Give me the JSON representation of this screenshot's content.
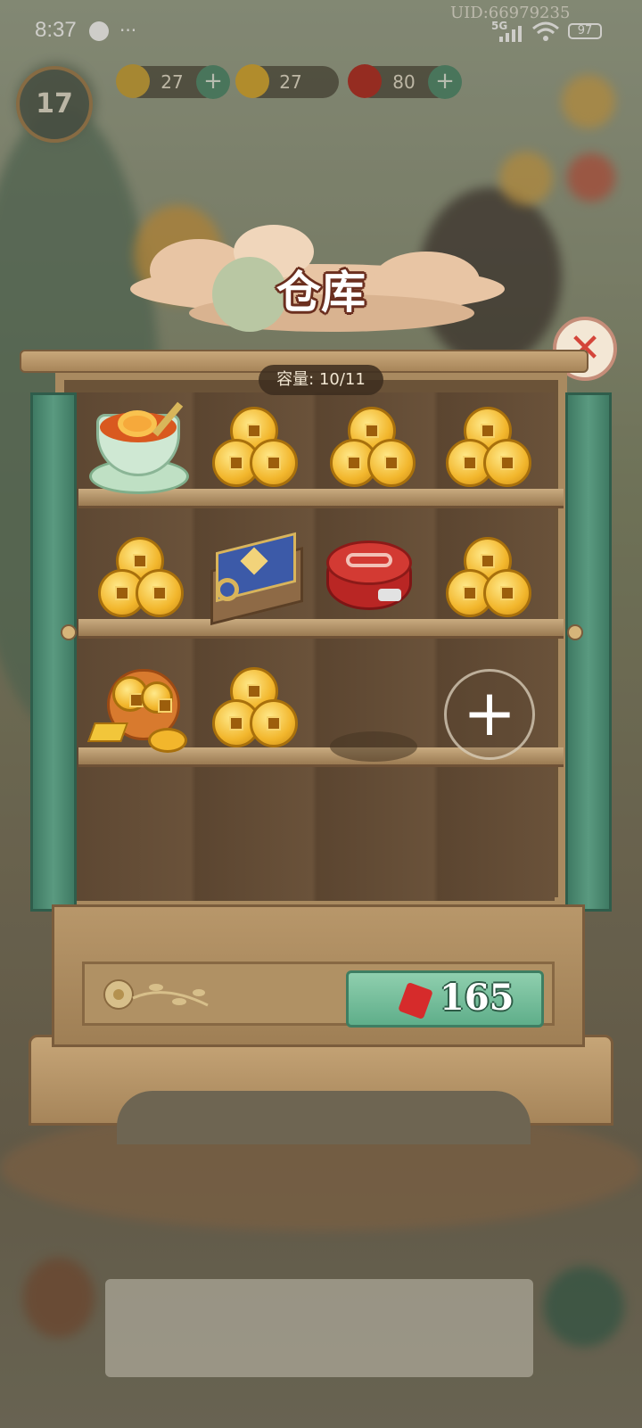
{
  "status_bar": {
    "time": "8:37",
    "dots": "···",
    "network": "5G",
    "battery": "97"
  },
  "uid": "UID:66979235",
  "hud": {
    "energy": "27",
    "coins": "27",
    "gems": "80",
    "level": "17"
  },
  "title": "仓库",
  "capacity": "容量: 10/11",
  "shelves": [
    [
      "sweet-soup-bowl-icon",
      "coin-stack-icon",
      "coin-stack-icon",
      "coin-stack-icon"
    ],
    [
      "coin-stack-icon",
      "blue-treasure-chest-icon",
      "red-tin-box-icon",
      "coin-stack-icon"
    ],
    [
      "lucky-coin-pouch-icon",
      "coin-stack-icon",
      "empty",
      "add-slot"
    ]
  ],
  "price": "165",
  "colors": {
    "door_green": "#4c8a70",
    "button_green": "#6cbd96",
    "close_red": "#d4453a",
    "gem_red": "#d62b2b"
  }
}
